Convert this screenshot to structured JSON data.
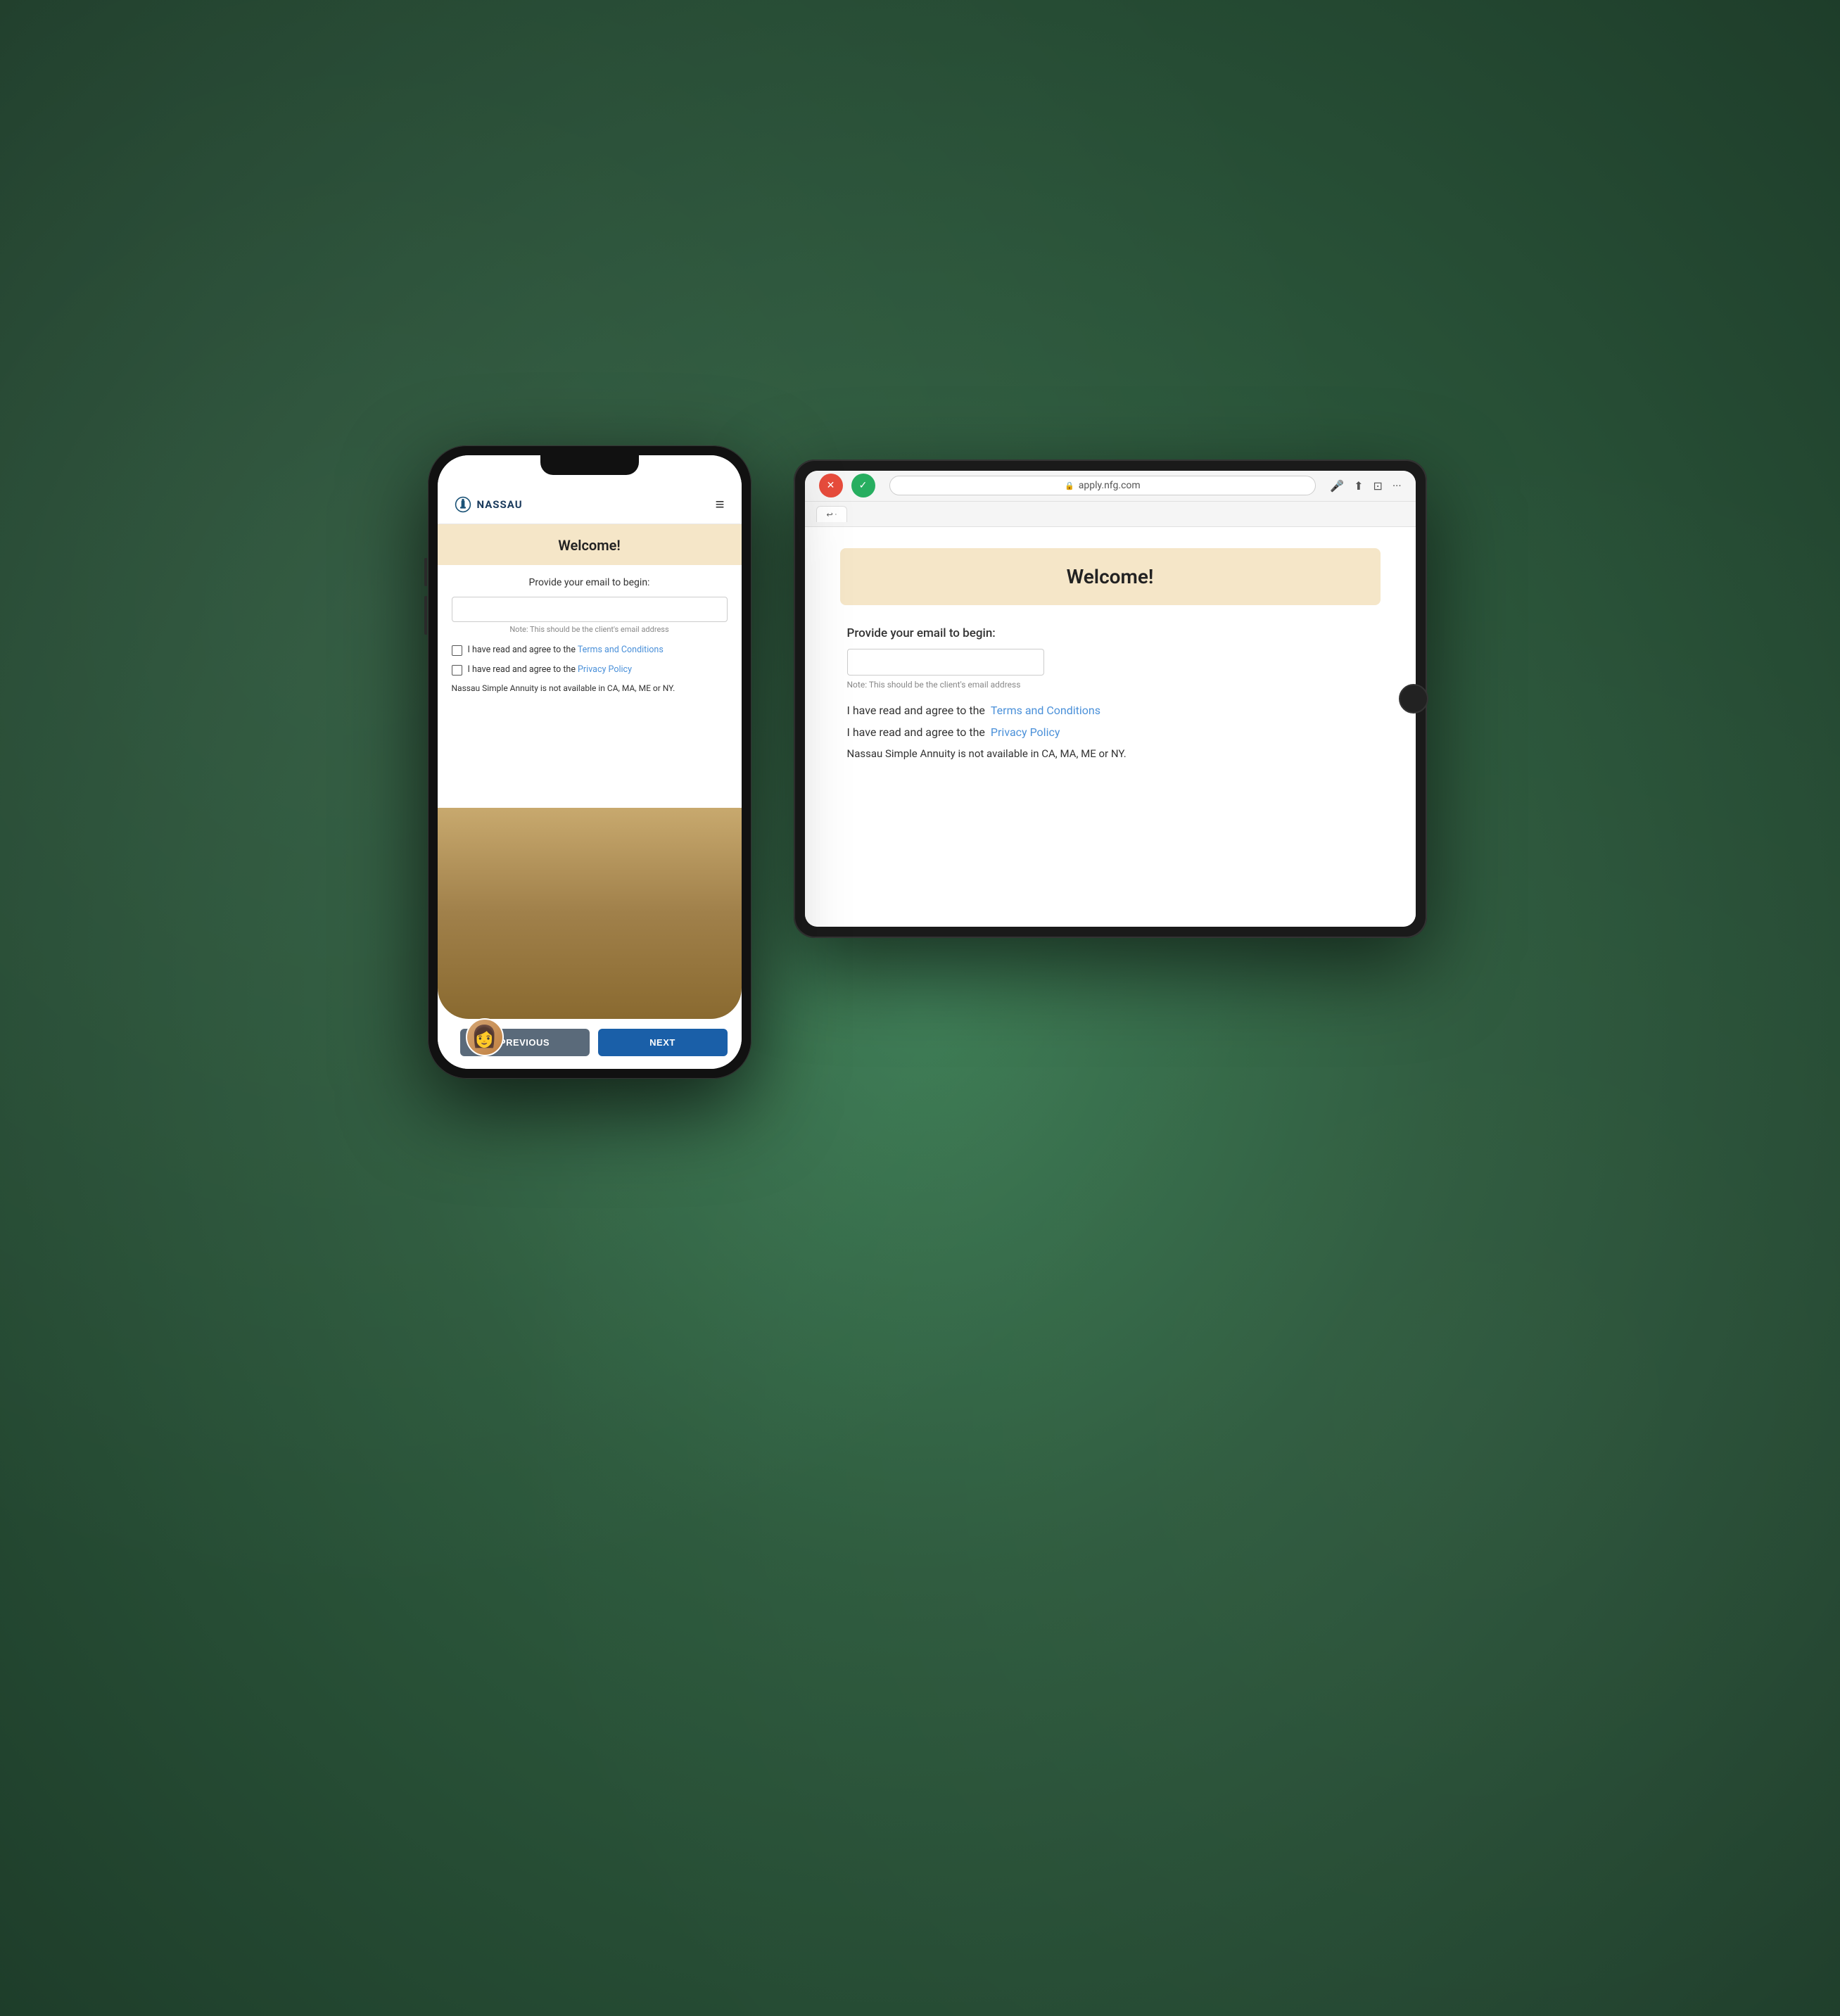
{
  "background": {
    "color": "#2d5a3d"
  },
  "phone": {
    "brand": "NASSAU",
    "navbar": {
      "logo_alt": "Nassau Logo",
      "hamburger_label": "≡"
    },
    "welcome_banner": {
      "title": "Welcome!"
    },
    "form": {
      "label": "Provide your email to begin:",
      "input_placeholder": "",
      "input_note": "Note: This should be the client's email address"
    },
    "agreements": {
      "terms_text": "I have read and agree to the ",
      "terms_link": "Terms and Conditions",
      "privacy_text": "I have read and agree to the ",
      "privacy_link": "Privacy Policy"
    },
    "availability_notice": "Nassau Simple Annuity is not available in CA, MA, ME or NY.",
    "buttons": {
      "previous": "PREVIOUS",
      "next": "NEXT"
    }
  },
  "tablet": {
    "statusbar": {
      "url": "apply.nfg.com"
    },
    "call_buttons": {
      "decline_label": "✕",
      "accept_label": "✓"
    },
    "welcome_banner": {
      "title": "Welcome!"
    },
    "form": {
      "label": "Provide your email to begin:",
      "input_placeholder": "",
      "input_note": "Note: This should be the client's email address"
    },
    "agreements": {
      "terms_text": "I have read and agree to the ",
      "terms_link": "Terms and Conditions",
      "privacy_text": "I have read and agree to the ",
      "privacy_link": "Privacy Policy"
    },
    "availability_notice": "Nassau Simple Annuity is not available in CA, MA, ME or NY."
  }
}
